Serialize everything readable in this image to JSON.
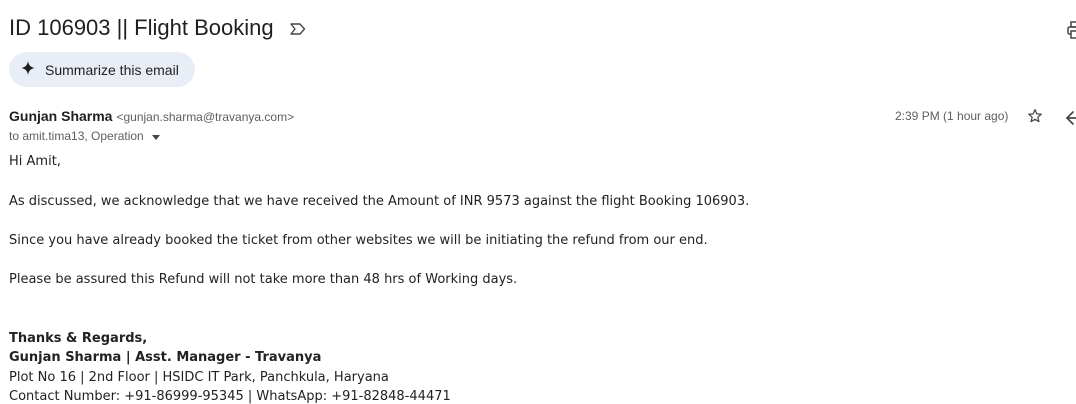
{
  "email": {
    "subject": "ID 106903 || Flight Booking",
    "summarize_label": "Summarize this email",
    "sender_name": "Gunjan Sharma",
    "sender_email": "<gunjan.sharma@travanya.com>",
    "recipients": "to amit.tima13, Operation",
    "time": "2:39 PM (1 hour ago)"
  },
  "body": {
    "greeting": "Hi Amit,",
    "para1": "As discussed, we acknowledge that we have received the Amount of INR 9573 against the flight Booking 106903.",
    "para2": "Since you have already booked the ticket from other websites we will be initiating the refund from our end.",
    "para3": "Please be assured this Refund will not take more than 48 hrs of Working days."
  },
  "signature": {
    "closing": "Thanks & Regards,",
    "name_title": "Gunjan Sharma | Asst. Manager - Travanya",
    "address": "Plot No 16 | 2nd Floor | HSIDC IT Park, Panchkula, Haryana",
    "contact": "Contact Number: +91-86999-95345 | WhatsApp: +91-82848-44471"
  },
  "icons": {
    "label": "label-icon",
    "print": "print-icon",
    "sparkle": "sparkle-icon",
    "star": "star-icon",
    "reply": "reply-icon",
    "caret": "chevron-down-icon"
  },
  "colors": {
    "chip_background": "#e9eef6",
    "text_primary": "#1f1f1f",
    "text_secondary": "#5e5e5e"
  }
}
